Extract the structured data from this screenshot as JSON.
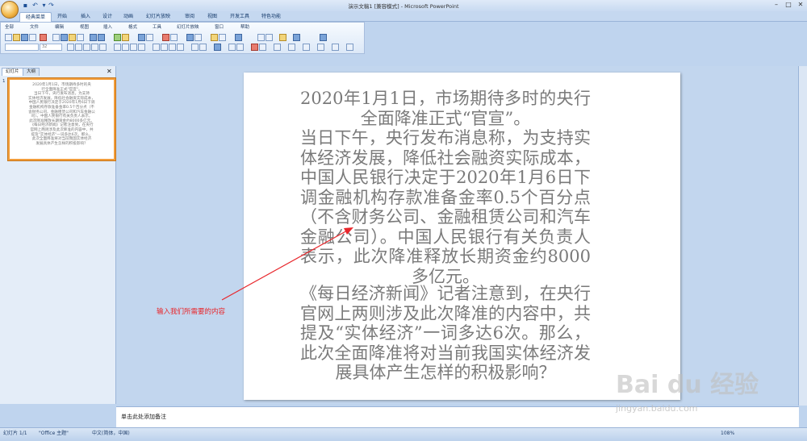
{
  "window": {
    "title": "演示文稿1 [兼容模式] - Microsoft PowerPoint"
  },
  "ribbon_tabs": [
    "经典菜单",
    "开始",
    "插入",
    "设计",
    "动画",
    "幻灯片放映",
    "审阅",
    "视图",
    "开发工具",
    "特色功能"
  ],
  "classic_menu": [
    "全部",
    "文件",
    "编辑",
    "视图",
    "插入",
    "格式",
    "工具",
    "幻灯片放映",
    "窗口",
    "帮助"
  ],
  "toolbar": {
    "font_size": "32"
  },
  "left_pane": {
    "tabs": [
      "幻灯片",
      "大纲"
    ],
    "slide_number": "1",
    "thumbnail_text": "2020年1月1日，市场期待多时的央\n行全面降准正式\"官宣\"。\n当日下午，央行发布消息，为支持\n实体经济发展，降低社会融资实际成本，\n中国人民银行决定于2020年1月6日下调\n金融机构存款准备金率0.5个百分点（不\n含财务公司、金融租赁公司和汽车金融公\n司）。中国人民银行有关负责人表示，\n此次降准释放长期资金约8000多亿元。\n《每日经济新闻》记者注意到，在央行\n官网上两则涉及此次降准的内容中，共\n提及\"实体经济\"一词多达6次。那么，\n此次全面降准将对当前我国实体经济\n发展具体产生怎样的积极影响？"
  },
  "slide": {
    "paragraphs": [
      "2020年1月1日，市场期待多时的央行全面降准正式“官宣”。",
      "当日下午，央行发布消息称，为支持实体经济发展，降低社会融资实际成本，中国人民银行决定于2020年1月6日下调金融机构存款准备金率0.5个百分点（不含财务公司、金融租赁公司和汽车金融公司）。中国人民银行有关负责人表示，此次降准释放长期资金约8000多亿元。",
      "《每日经济新闻》记者注意到，在央行官网上两则涉及此次降准的内容中，共提及“实体经济”一词多达6次。那么，此次全面降准将对当前我国实体经济发展具体产生怎样的积极影响？"
    ]
  },
  "annotation": {
    "text": "输入我们所需要的内容",
    "color": "#e8262b"
  },
  "notes": {
    "placeholder": "单击此处添加备注"
  },
  "status_bar": {
    "slide_count": "幻灯片 1/1",
    "theme": "\"Office 主题\"",
    "language": "中文(简体，中国)",
    "zoom": "108%"
  },
  "watermark": {
    "logo": "Bai du 经验",
    "url": "jingyan.baidu.com"
  },
  "colors": {
    "selection_border": "#f29d3a",
    "slide_text": "#7a7a7a",
    "ribbon_bg": "#dce8f7"
  }
}
